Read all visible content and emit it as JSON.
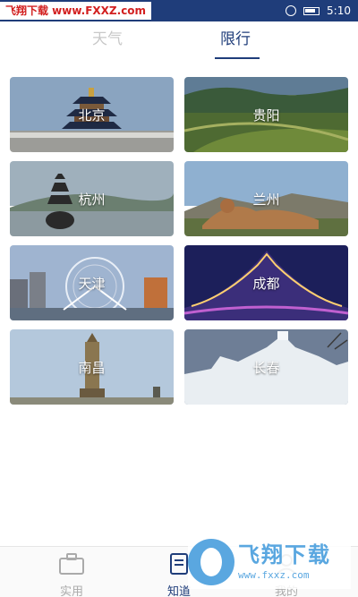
{
  "status_bar": {
    "watermark": "飞翔下载 www.FXXZ.com",
    "time": "5:10"
  },
  "tabs": [
    {
      "label": "天气",
      "active": false
    },
    {
      "label": "限行",
      "active": true
    }
  ],
  "cities": [
    {
      "name": "北京"
    },
    {
      "name": "贵阳"
    },
    {
      "name": "杭州"
    },
    {
      "name": "兰州"
    },
    {
      "name": "天津"
    },
    {
      "name": "成都"
    },
    {
      "name": "南昌"
    },
    {
      "name": "长春"
    }
  ],
  "bottom_nav": [
    {
      "label": "实用",
      "icon": "briefcase-icon",
      "active": false
    },
    {
      "label": "知道",
      "icon": "book-icon",
      "active": true
    },
    {
      "label": "我的",
      "icon": "user-icon",
      "active": false
    }
  ],
  "watermark_logo": {
    "text": "飞翔下载",
    "url": "www.fxxz.com"
  },
  "colors": {
    "primary": "#1f3d7a",
    "inactive": "#aaaaaa"
  }
}
